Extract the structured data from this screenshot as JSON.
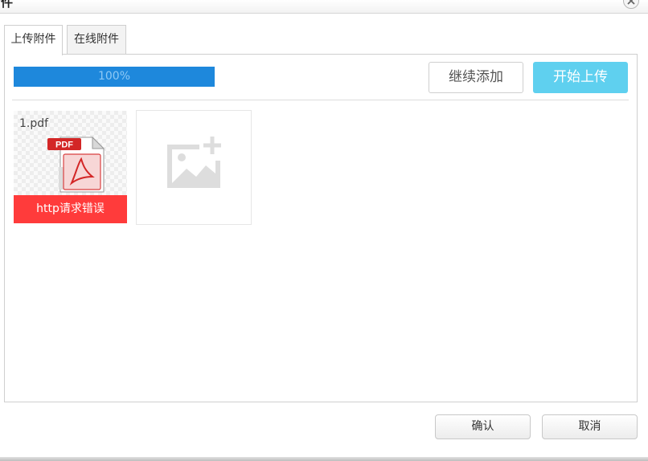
{
  "dialog": {
    "title": "附件"
  },
  "tabs": [
    {
      "label": "上传附件",
      "active": true
    },
    {
      "label": "在线附件",
      "active": false
    }
  ],
  "upload": {
    "progress_percent": 100,
    "progress_label": "100%",
    "continue_label": "继续添加",
    "start_label": "开始上传"
  },
  "files": [
    {
      "name": "1.pdf",
      "type_badge": "PDF",
      "error": "http请求错误"
    }
  ],
  "footer": {
    "confirm_label": "确认",
    "cancel_label": "取消"
  },
  "colors": {
    "progress_fill": "#1e88dc",
    "start_button": "#5fd0ef",
    "error_bar": "#ff3b3b"
  }
}
